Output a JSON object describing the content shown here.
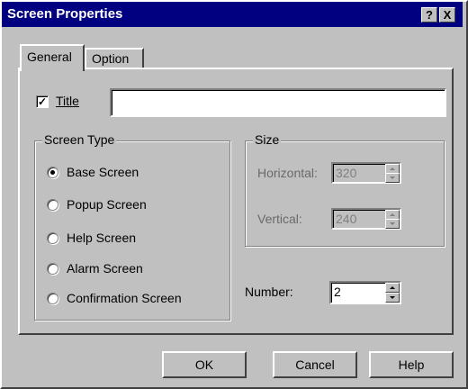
{
  "window": {
    "title": "Screen Properties",
    "help_icon": "?",
    "close_icon": "X"
  },
  "tabs": [
    {
      "label": "General",
      "active": true
    },
    {
      "label": "Option",
      "active": false
    }
  ],
  "title_field": {
    "checked": true,
    "label": "Title",
    "value": ""
  },
  "screen_type": {
    "legend": "Screen Type",
    "options": [
      {
        "label": "Base Screen",
        "selected": true
      },
      {
        "label": "Popup Screen",
        "selected": false
      },
      {
        "label": "Help Screen",
        "selected": false
      },
      {
        "label": "Alarm Screen",
        "selected": false
      },
      {
        "label": "Confirmation Screen",
        "selected": false
      }
    ]
  },
  "size": {
    "legend": "Size",
    "horizontal_label": "Horizontal:",
    "horizontal_value": "320",
    "vertical_label": "Vertical:",
    "vertical_value": "240"
  },
  "number": {
    "label": "Number:",
    "value": "2"
  },
  "buttons": {
    "ok": "OK",
    "cancel": "Cancel",
    "help": "Help"
  }
}
